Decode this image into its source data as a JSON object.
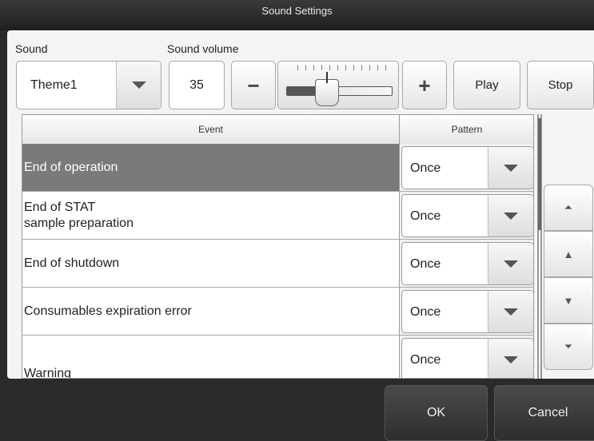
{
  "window": {
    "title": "Sound Settings"
  },
  "sound": {
    "label": "Sound",
    "selected": "Theme1",
    "volume_label": "Sound volume",
    "volume_value": "35",
    "minus": "−",
    "plus": "+",
    "play_label": "Play",
    "stop_label": "Stop"
  },
  "table": {
    "headers": {
      "event": "Event",
      "pattern": "Pattern"
    },
    "rows": [
      {
        "event": "End of operation",
        "pattern": "Once"
      },
      {
        "event": "End of STAT\nsample preparation",
        "pattern": "Once"
      },
      {
        "event": "End of shutdown",
        "pattern": "Once"
      },
      {
        "event": "Consumables expiration error",
        "pattern": "Once"
      },
      {
        "event": "Warning",
        "pattern": "Once"
      }
    ]
  },
  "nav": {
    "first": "⏶",
    "up": "▲",
    "down": "▼",
    "last": "⏷"
  },
  "footer": {
    "ok_label": "OK",
    "cancel_label": "Cancel"
  },
  "colors": {
    "selected_row": "#7a7a7a",
    "background": "#2a2a2a"
  }
}
